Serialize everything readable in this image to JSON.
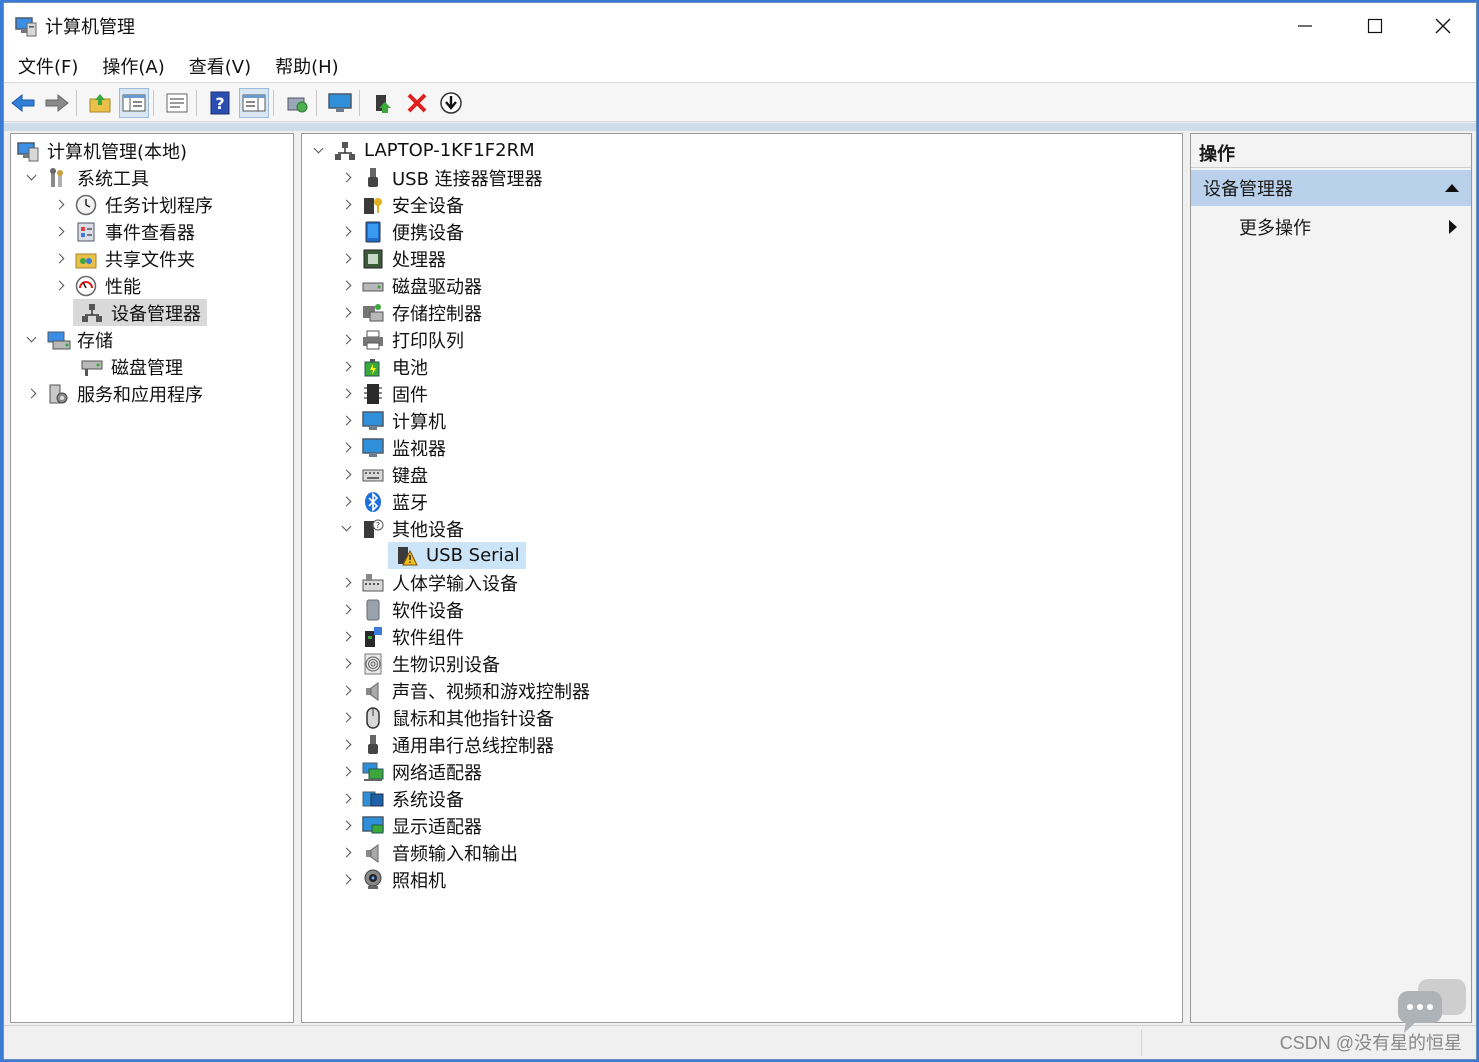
{
  "window": {
    "title": "计算机管理",
    "controls": {
      "minimize": "—",
      "maximize": "☐",
      "close": "✕"
    }
  },
  "menu": [
    "文件(F)",
    "操作(A)",
    "查看(V)",
    "帮助(H)"
  ],
  "toolbar": [
    "back-icon",
    "forward-icon",
    "up-folder-icon",
    "show-tree-icon",
    "properties-icon",
    "help-icon",
    "view-icon",
    "scan-hardware-icon",
    "display-icon",
    "update-driver-icon",
    "uninstall-icon",
    "download-icon"
  ],
  "left_tree": [
    {
      "label": "计算机管理(本地)",
      "level": 0,
      "chevron": "none",
      "icon": "computer-management-icon"
    },
    {
      "label": "系统工具",
      "level": 1,
      "chevron": "down",
      "icon": "system-tools-icon"
    },
    {
      "label": "任务计划程序",
      "level": 2,
      "chevron": "right",
      "icon": "clock-icon"
    },
    {
      "label": "事件查看器",
      "level": 2,
      "chevron": "right",
      "icon": "event-viewer-icon"
    },
    {
      "label": "共享文件夹",
      "level": 2,
      "chevron": "right",
      "icon": "shared-folder-icon"
    },
    {
      "label": "性能",
      "level": 2,
      "chevron": "right",
      "icon": "performance-icon"
    },
    {
      "label": "设备管理器",
      "level": 2,
      "chevron": "none",
      "icon": "device-manager-icon",
      "selected": true
    },
    {
      "label": "存储",
      "level": 1,
      "chevron": "down",
      "icon": "storage-icon"
    },
    {
      "label": "磁盘管理",
      "level": 2,
      "chevron": "none",
      "icon": "disk-management-icon"
    },
    {
      "label": "服务和应用程序",
      "level": 1,
      "chevron": "right",
      "icon": "services-icon"
    }
  ],
  "device_tree": {
    "root": "LAPTOP-1KF1F2RM",
    "items": [
      {
        "label": "USB 连接器管理器",
        "icon": "usb-icon",
        "chevron": "right"
      },
      {
        "label": "安全设备",
        "icon": "security-key-icon",
        "chevron": "right"
      },
      {
        "label": "便携设备",
        "icon": "portable-device-icon",
        "chevron": "right"
      },
      {
        "label": "处理器",
        "icon": "processor-icon",
        "chevron": "right"
      },
      {
        "label": "磁盘驱动器",
        "icon": "disk-drive-icon",
        "chevron": "right"
      },
      {
        "label": "存储控制器",
        "icon": "storage-controller-icon",
        "chevron": "right"
      },
      {
        "label": "打印队列",
        "icon": "printer-icon",
        "chevron": "right"
      },
      {
        "label": "电池",
        "icon": "battery-icon",
        "chevron": "right"
      },
      {
        "label": "固件",
        "icon": "firmware-icon",
        "chevron": "right"
      },
      {
        "label": "计算机",
        "icon": "computer-icon",
        "chevron": "right"
      },
      {
        "label": "监视器",
        "icon": "monitor-icon",
        "chevron": "right"
      },
      {
        "label": "键盘",
        "icon": "keyboard-icon",
        "chevron": "right"
      },
      {
        "label": "蓝牙",
        "icon": "bluetooth-icon",
        "chevron": "right"
      },
      {
        "label": "其他设备",
        "icon": "other-devices-icon",
        "chevron": "down"
      },
      {
        "label": "USB Serial",
        "icon": "warning-device-icon",
        "chevron": "none",
        "child": true,
        "selected": true
      },
      {
        "label": "人体学输入设备",
        "icon": "hid-icon",
        "chevron": "right"
      },
      {
        "label": "软件设备",
        "icon": "software-device-icon",
        "chevron": "right"
      },
      {
        "label": "软件组件",
        "icon": "software-component-icon",
        "chevron": "right"
      },
      {
        "label": "生物识别设备",
        "icon": "fingerprint-icon",
        "chevron": "right"
      },
      {
        "label": "声音、视频和游戏控制器",
        "icon": "speaker-icon",
        "chevron": "right"
      },
      {
        "label": "鼠标和其他指针设备",
        "icon": "mouse-icon",
        "chevron": "right"
      },
      {
        "label": "通用串行总线控制器",
        "icon": "usb-controller-icon",
        "chevron": "right"
      },
      {
        "label": "网络适配器",
        "icon": "network-adapter-icon",
        "chevron": "right"
      },
      {
        "label": "系统设备",
        "icon": "system-device-icon",
        "chevron": "right"
      },
      {
        "label": "显示适配器",
        "icon": "display-adapter-icon",
        "chevron": "right"
      },
      {
        "label": "音频输入和输出",
        "icon": "audio-io-icon",
        "chevron": "right"
      },
      {
        "label": "照相机",
        "icon": "camera-icon",
        "chevron": "right"
      }
    ]
  },
  "actions": {
    "header": "操作",
    "section": "设备管理器",
    "item": "更多操作"
  },
  "watermark": "CSDN @没有星的恒星"
}
